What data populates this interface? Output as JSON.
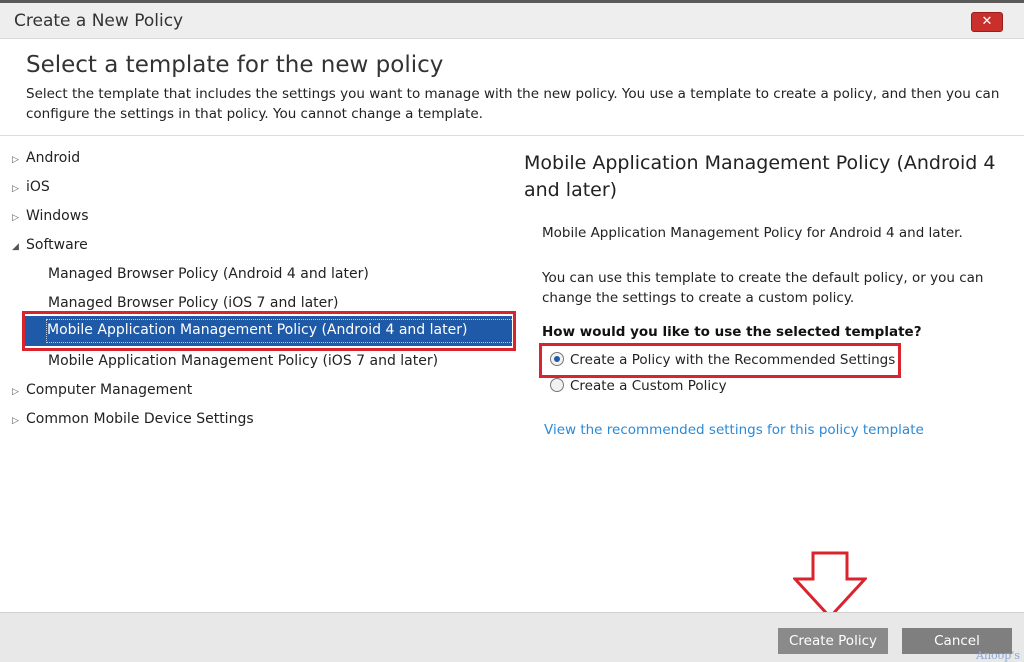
{
  "window": {
    "title": "Create a New Policy",
    "close_glyph": "✕"
  },
  "header": {
    "heading": "Select a template for the new policy",
    "description": "Select the template that includes the settings you want to manage with the new policy. You use a template to create a policy, and then you can configure the settings in that policy. You cannot change a template."
  },
  "tree": {
    "items": [
      {
        "label": "Android",
        "expanded": false
      },
      {
        "label": "iOS",
        "expanded": false
      },
      {
        "label": "Windows",
        "expanded": false
      },
      {
        "label": "Software",
        "expanded": true
      },
      {
        "label": "Computer Management",
        "expanded": false
      },
      {
        "label": "Common Mobile Device Settings",
        "expanded": false
      }
    ],
    "software_children": [
      {
        "label": "Managed Browser Policy (Android 4 and later)"
      },
      {
        "label": "Managed Browser Policy (iOS 7 and later)"
      },
      {
        "label": "Mobile Application Management Policy (Android 4 and later)",
        "selected": true
      },
      {
        "label": "Mobile Application Management Policy (iOS 7 and later)"
      }
    ],
    "collapsed_icon": "▷",
    "expanded_icon": "◢"
  },
  "details": {
    "title": "Mobile Application Management Policy (Android 4 and later)",
    "summary": "Mobile Application Management Policy for Android 4 and later.",
    "info": "You can use this template to create the default policy, or you can change the settings to create a custom policy.",
    "question": "How would you like to use the selected template?",
    "options": [
      {
        "label": "Create a Policy with the Recommended Settings",
        "selected": true
      },
      {
        "label": "Create a Custom Policy",
        "selected": false
      }
    ],
    "link": "View the recommended settings for this policy template"
  },
  "footer": {
    "create_label": "Create Policy",
    "cancel_label": "Cancel"
  },
  "watermark": "Anoop's",
  "colors": {
    "selection": "#1e5aa8",
    "highlight_box": "#d9232d",
    "link": "#2a8ad8",
    "close_button": "#c9302c"
  }
}
